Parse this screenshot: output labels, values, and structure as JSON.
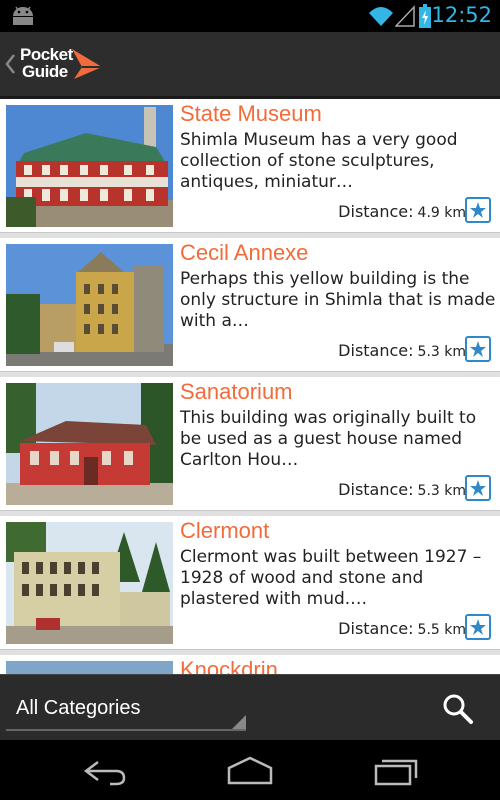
{
  "status_bar": {
    "time": "12:52",
    "icons": [
      "android-icon",
      "wifi-icon",
      "signal-icon",
      "battery-icon"
    ]
  },
  "action_bar": {
    "logo_line1": "Pocket",
    "logo_line2": "Guide",
    "accent_color": "#f26b3a"
  },
  "places": [
    {
      "title": "State Museum",
      "description": "Shimla Museum has a very good collection of stone sculptures, antiques, miniatur…",
      "distance_label": "Distance:",
      "distance": "4.9 km"
    },
    {
      "title": "Cecil Annexe",
      "description": "Perhaps this yellow building is the only structure in Shimla that is made with a…",
      "distance_label": "Distance:",
      "distance": "5.3 km"
    },
    {
      "title": "Sanatorium",
      "description": "This building was originally built to be used as a guest house named Carlton Hou…",
      "distance_label": "Distance:",
      "distance": "5.3 km"
    },
    {
      "title": "Clermont",
      "description": "Clermont was built between 1927 – 1928 of wood and stone and plastered with mud.…",
      "distance_label": "Distance:",
      "distance": "5.5 km"
    },
    {
      "title": "Knockdrin",
      "description": "",
      "distance_label": "",
      "distance": ""
    }
  ],
  "bottom_bar": {
    "category": "All Categories"
  },
  "nav_bar": {
    "buttons": [
      "back-icon",
      "home-icon",
      "recent-apps-icon"
    ]
  }
}
